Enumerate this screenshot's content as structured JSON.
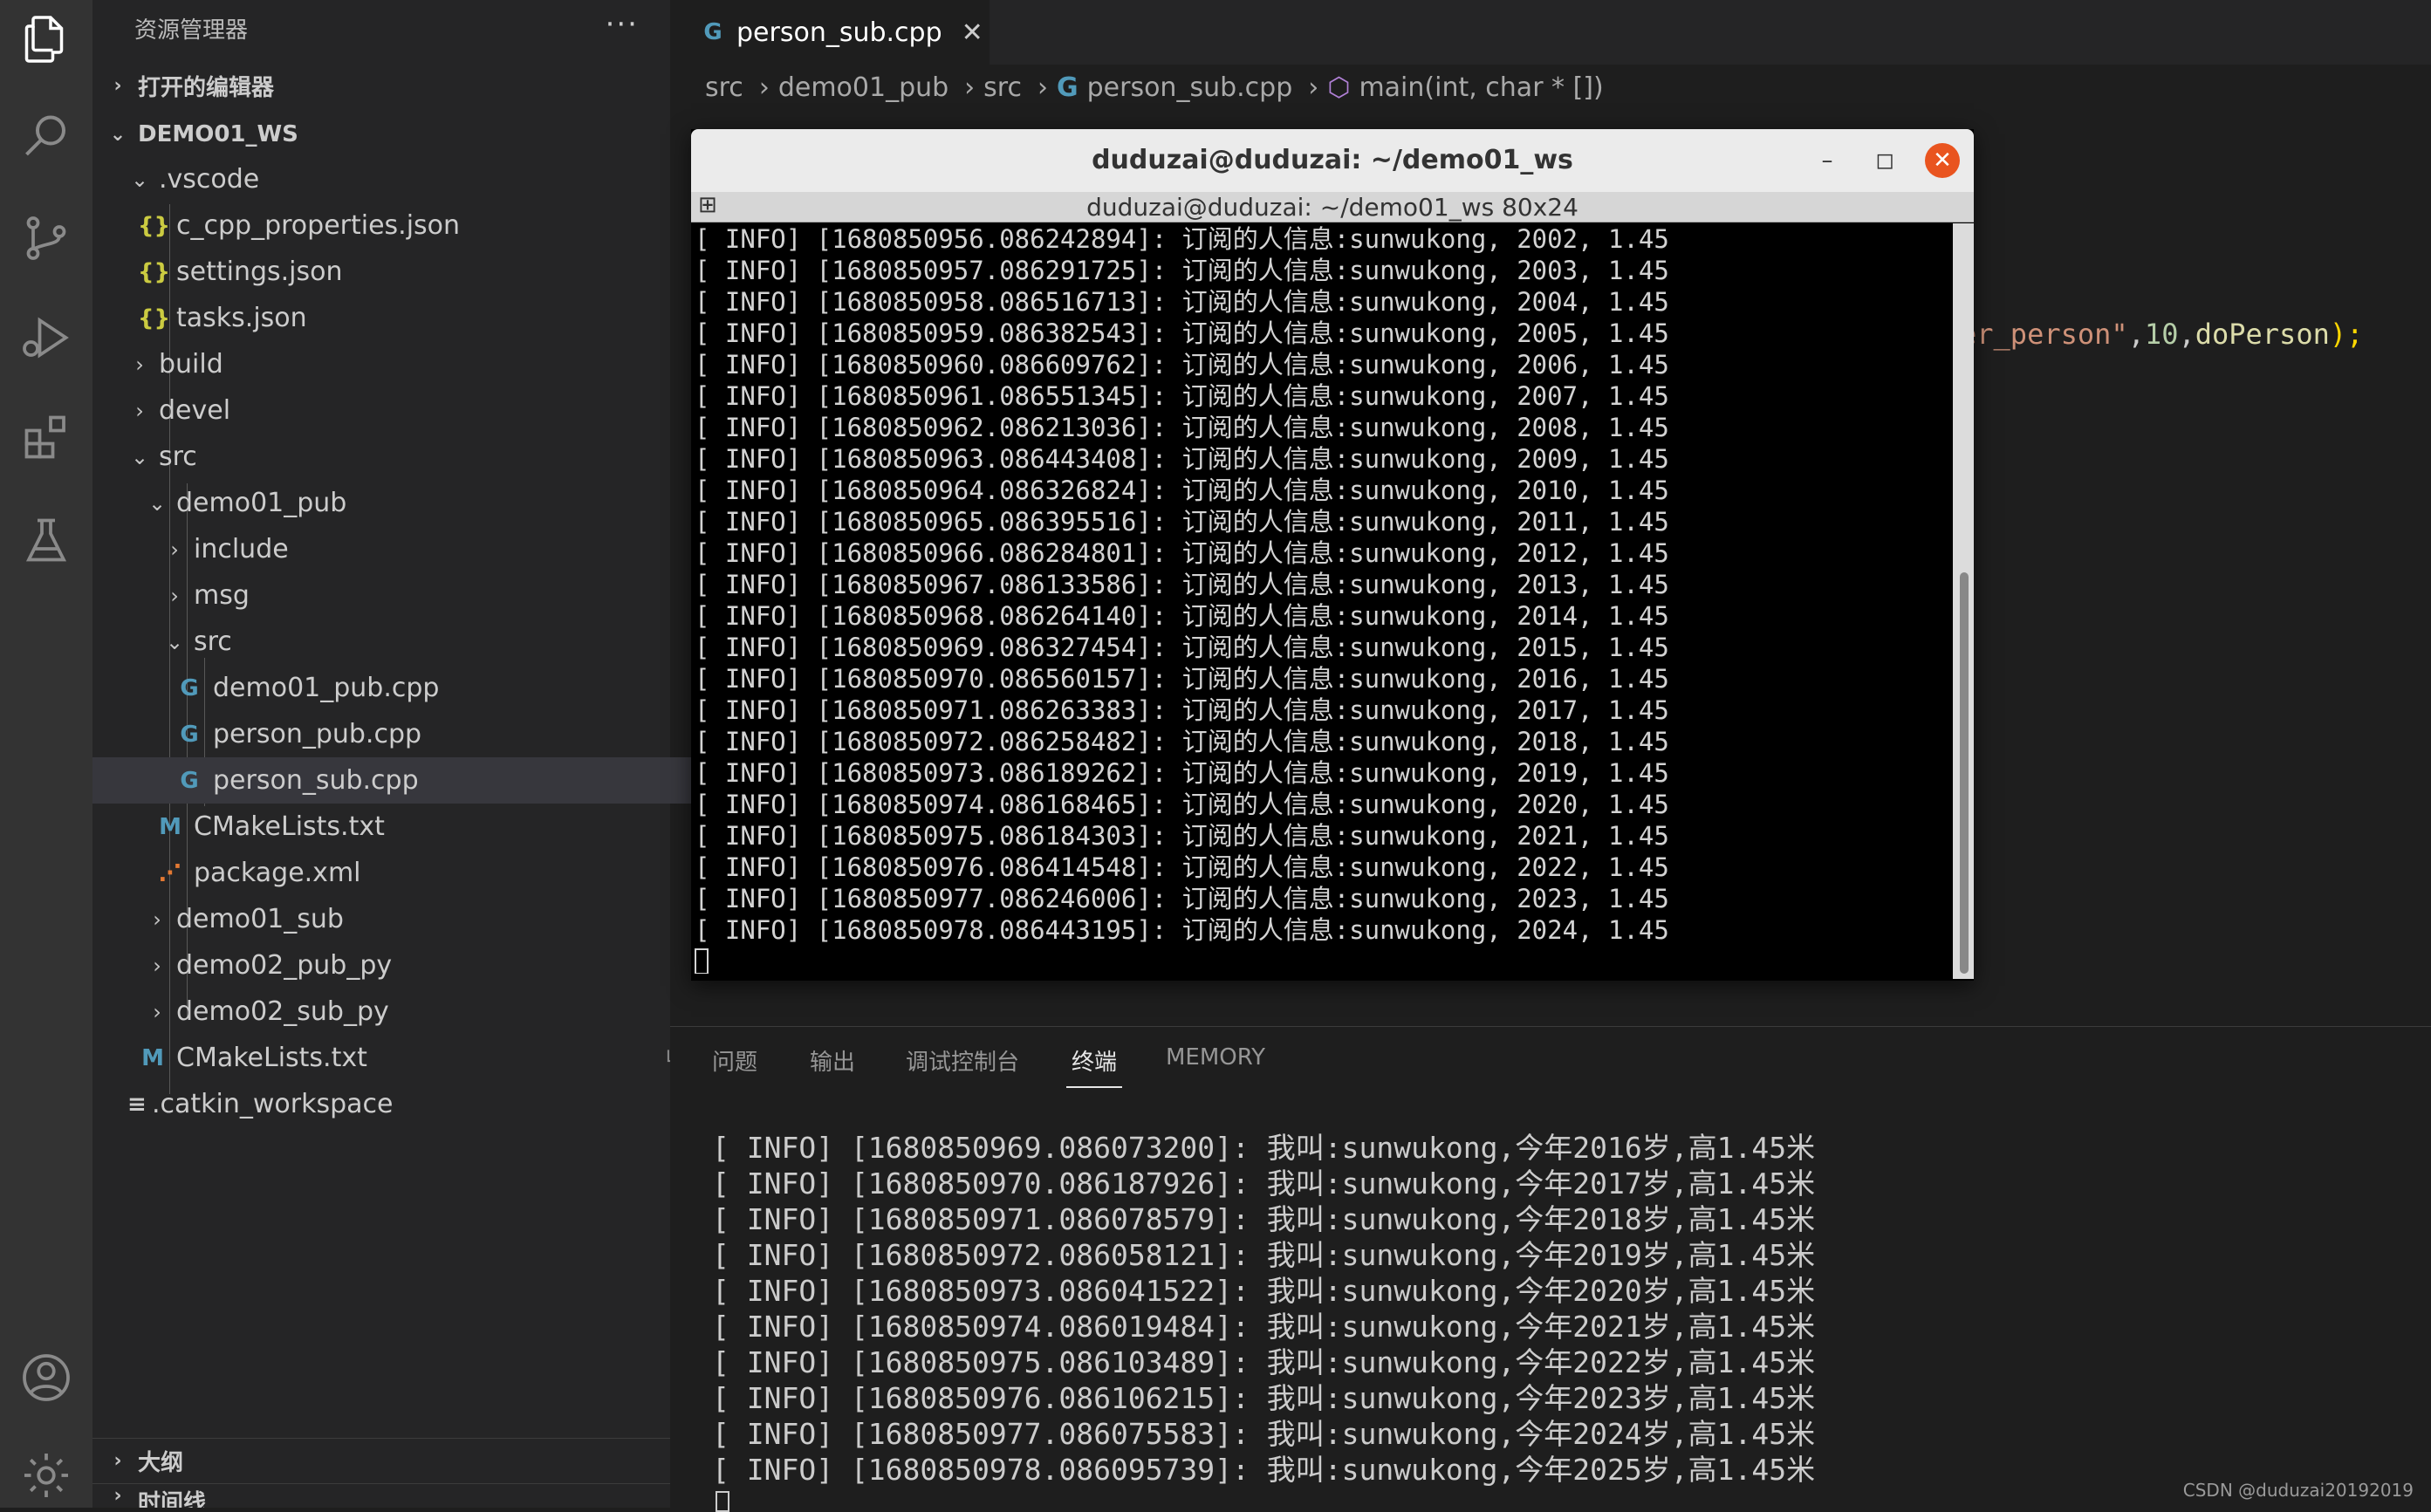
{
  "sidebar": {
    "title": "资源管理器",
    "more": "···",
    "open_editors": "打开的编辑器",
    "workspace": "DEMO01_WS",
    "outline": "大纲",
    "timeline": "时间线",
    "tree": [
      {
        "label": ".vscode",
        "type": "folder-open"
      },
      {
        "label": "c_cpp_properties.json",
        "type": "json"
      },
      {
        "label": "settings.json",
        "type": "json"
      },
      {
        "label": "tasks.json",
        "type": "json"
      },
      {
        "label": "build",
        "type": "folder"
      },
      {
        "label": "devel",
        "type": "folder"
      },
      {
        "label": "src",
        "type": "folder-open"
      },
      {
        "label": "demo01_pub",
        "type": "folder-open"
      },
      {
        "label": "include",
        "type": "folder"
      },
      {
        "label": "msg",
        "type": "folder"
      },
      {
        "label": "src",
        "type": "folder-open"
      },
      {
        "label": "demo01_pub.cpp",
        "type": "cpp"
      },
      {
        "label": "person_pub.cpp",
        "type": "cpp"
      },
      {
        "label": "person_sub.cpp",
        "type": "cpp"
      },
      {
        "label": "CMakeLists.txt",
        "type": "cmake"
      },
      {
        "label": "package.xml",
        "type": "xml"
      },
      {
        "label": "demo01_sub",
        "type": "folder"
      },
      {
        "label": "demo02_pub_py",
        "type": "folder"
      },
      {
        "label": "demo02_sub_py",
        "type": "folder"
      },
      {
        "label": "CMakeLists.txt",
        "type": "cmake"
      },
      {
        "label": ".catkin_workspace",
        "type": "lines"
      }
    ]
  },
  "editor": {
    "tab_label": "person_sub.cpp",
    "breadcrumb": [
      "src",
      "demo01_pub",
      "src",
      "person_sub.cpp",
      "main(int, char * [])"
    ],
    "code_fragment": {
      "p1": "er_person\"",
      "p2": ",",
      "p3": "10",
      "p4": ",",
      "p5": "doPerson",
      "p6": ");"
    }
  },
  "terminal_window": {
    "title": "duduzai@duduzai: ~/demo01_ws",
    "subtitle": "duduzai@duduzai: ~/demo01_ws 80x24",
    "lines": [
      "[ INFO] [1680850956.086242894]: 订阅的人信息:sunwukong, 2002, 1.45",
      "[ INFO] [1680850957.086291725]: 订阅的人信息:sunwukong, 2003, 1.45",
      "[ INFO] [1680850958.086516713]: 订阅的人信息:sunwukong, 2004, 1.45",
      "[ INFO] [1680850959.086382543]: 订阅的人信息:sunwukong, 2005, 1.45",
      "[ INFO] [1680850960.086609762]: 订阅的人信息:sunwukong, 2006, 1.45",
      "[ INFO] [1680850961.086551345]: 订阅的人信息:sunwukong, 2007, 1.45",
      "[ INFO] [1680850962.086213036]: 订阅的人信息:sunwukong, 2008, 1.45",
      "[ INFO] [1680850963.086443408]: 订阅的人信息:sunwukong, 2009, 1.45",
      "[ INFO] [1680850964.086326824]: 订阅的人信息:sunwukong, 2010, 1.45",
      "[ INFO] [1680850965.086395516]: 订阅的人信息:sunwukong, 2011, 1.45",
      "[ INFO] [1680850966.086284801]: 订阅的人信息:sunwukong, 2012, 1.45",
      "[ INFO] [1680850967.086133586]: 订阅的人信息:sunwukong, 2013, 1.45",
      "[ INFO] [1680850968.086264140]: 订阅的人信息:sunwukong, 2014, 1.45",
      "[ INFO] [1680850969.086327454]: 订阅的人信息:sunwukong, 2015, 1.45",
      "[ INFO] [1680850970.086560157]: 订阅的人信息:sunwukong, 2016, 1.45",
      "[ INFO] [1680850971.086263383]: 订阅的人信息:sunwukong, 2017, 1.45",
      "[ INFO] [1680850972.086258482]: 订阅的人信息:sunwukong, 2018, 1.45",
      "[ INFO] [1680850973.086189262]: 订阅的人信息:sunwukong, 2019, 1.45",
      "[ INFO] [1680850974.086168465]: 订阅的人信息:sunwukong, 2020, 1.45",
      "[ INFO] [1680850975.086184303]: 订阅的人信息:sunwukong, 2021, 1.45",
      "[ INFO] [1680850976.086414548]: 订阅的人信息:sunwukong, 2022, 1.45",
      "[ INFO] [1680850977.086246006]: 订阅的人信息:sunwukong, 2023, 1.45",
      "[ INFO] [1680850978.086443195]: 订阅的人信息:sunwukong, 2024, 1.45"
    ]
  },
  "panel": {
    "tabs": [
      "问题",
      "输出",
      "调试控制台",
      "终端",
      "MEMORY"
    ],
    "active_tab": "终端",
    "lines": [
      "[ INFO] [1680850969.086073200]: 我叫:sunwukong,今年2016岁,高1.45米",
      "[ INFO] [1680850970.086187926]: 我叫:sunwukong,今年2017岁,高1.45米",
      "[ INFO] [1680850971.086078579]: 我叫:sunwukong,今年2018岁,高1.45米",
      "[ INFO] [1680850972.086058121]: 我叫:sunwukong,今年2019岁,高1.45米",
      "[ INFO] [1680850973.086041522]: 我叫:sunwukong,今年2020岁,高1.45米",
      "[ INFO] [1680850974.086019484]: 我叫:sunwukong,今年2021岁,高1.45米",
      "[ INFO] [1680850975.086103489]: 我叫:sunwukong,今年2022岁,高1.45米",
      "[ INFO] [1680850976.086106215]: 我叫:sunwukong,今年2023岁,高1.45米",
      "[ INFO] [1680850977.086075583]: 我叫:sunwukong,今年2024岁,高1.45米",
      "[ INFO] [1680850978.086095739]: 我叫:sunwukong,今年2025岁,高1.45米"
    ]
  },
  "watermark": "CSDN @duduzai20192019",
  "icons": {
    "activity": [
      "explorer-icon",
      "search-icon",
      "source-control-icon",
      "run-debug-icon",
      "extensions-icon",
      "testing-icon",
      "account-icon",
      "settings-gear-icon"
    ]
  },
  "colors": {
    "activity_bar": "#333333",
    "sidebar": "#252526",
    "editor": "#1e1e1e",
    "selected_row": "#37373d",
    "close_button": "#e9541f",
    "code_string": "#ce9178",
    "code_number": "#b5cea8",
    "code_function": "#dcdcaa",
    "json_icon": "#cbcb41",
    "cpp_icon": "#519aba",
    "xml_icon": "#e37933"
  }
}
